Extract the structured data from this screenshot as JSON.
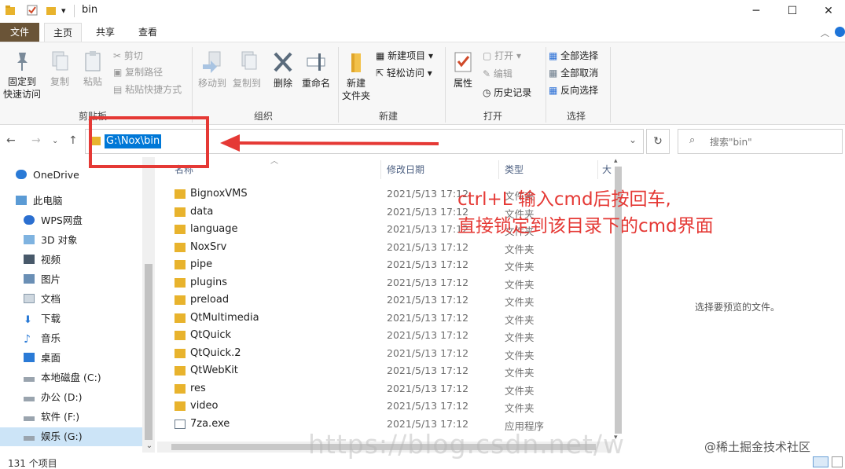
{
  "window": {
    "title": "bin",
    "quick_access_arrow": "▾",
    "controls": {
      "minimize": "─",
      "maximize": "☐",
      "close": "✕"
    }
  },
  "ribbon_tabs": [
    "文件",
    "主页",
    "共享",
    "查看"
  ],
  "ribbon": {
    "clipboard": {
      "pin_label_1": "固定到",
      "pin_label_2": "快速访问",
      "copy": "复制",
      "paste": "粘贴",
      "cut": "剪切",
      "copy_path": "复制路径",
      "paste_shortcut": "粘贴快捷方式",
      "group_label": "剪贴板"
    },
    "organize": {
      "move_to": "移动到",
      "copy_to": "复制到",
      "delete": "删除",
      "rename": "重命名",
      "group_label": "组织"
    },
    "new": {
      "new_folder_1": "新建",
      "new_folder_2": "文件夹",
      "new_item": "新建项目",
      "easy_access": "轻松访问",
      "group_label": "新建"
    },
    "open": {
      "properties": "属性",
      "open": "打开",
      "edit": "编辑",
      "history": "历史记录",
      "group_label": "打开"
    },
    "select": {
      "select_all": "全部选择",
      "select_none": "全部取消",
      "invert": "反向选择",
      "group_label": "选择"
    }
  },
  "address": {
    "path": "G:\\Nox\\bin",
    "search_placeholder": "搜索\"bin\""
  },
  "nav_pane": [
    {
      "label": "OneDrive",
      "icon": "cloud-icon"
    },
    {
      "label": "此电脑",
      "icon": "computer-icon"
    },
    {
      "label": "WPS网盘",
      "icon": "cloud-drive-icon"
    },
    {
      "label": "3D 对象",
      "icon": "cube-icon"
    },
    {
      "label": "视频",
      "icon": "video-icon"
    },
    {
      "label": "图片",
      "icon": "picture-icon"
    },
    {
      "label": "文档",
      "icon": "document-icon"
    },
    {
      "label": "下载",
      "icon": "download-icon"
    },
    {
      "label": "音乐",
      "icon": "music-icon"
    },
    {
      "label": "桌面",
      "icon": "desktop-icon"
    },
    {
      "label": "本地磁盘 (C:)",
      "icon": "drive-icon"
    },
    {
      "label": "办公 (D:)",
      "icon": "drive-icon"
    },
    {
      "label": "软件 (F:)",
      "icon": "drive-icon"
    },
    {
      "label": "娱乐 (G:)",
      "icon": "drive-icon"
    }
  ],
  "columns": {
    "name": "名称",
    "date": "修改日期",
    "type": "类型",
    "size": "大"
  },
  "files": [
    {
      "name": "BignoxVMS",
      "date": "2021/5/13 17:12",
      "type": "文件夹",
      "icon": "folder-icon"
    },
    {
      "name": "data",
      "date": "2021/5/13 17:12",
      "type": "文件夹",
      "icon": "folder-icon"
    },
    {
      "name": "language",
      "date": "2021/5/13 17:12",
      "type": "文件夹",
      "icon": "folder-icon"
    },
    {
      "name": "NoxSrv",
      "date": "2021/5/13 17:12",
      "type": "文件夹",
      "icon": "folder-icon"
    },
    {
      "name": "pipe",
      "date": "2021/5/13 17:12",
      "type": "文件夹",
      "icon": "folder-icon"
    },
    {
      "name": "plugins",
      "date": "2021/5/13 17:12",
      "type": "文件夹",
      "icon": "folder-icon"
    },
    {
      "name": "preload",
      "date": "2021/5/13 17:12",
      "type": "文件夹",
      "icon": "folder-icon"
    },
    {
      "name": "QtMultimedia",
      "date": "2021/5/13 17:12",
      "type": "文件夹",
      "icon": "folder-icon"
    },
    {
      "name": "QtQuick",
      "date": "2021/5/13 17:12",
      "type": "文件夹",
      "icon": "folder-icon"
    },
    {
      "name": "QtQuick.2",
      "date": "2021/5/13 17:12",
      "type": "文件夹",
      "icon": "folder-icon"
    },
    {
      "name": "QtWebKit",
      "date": "2021/5/13 17:12",
      "type": "文件夹",
      "icon": "folder-icon"
    },
    {
      "name": "res",
      "date": "2021/5/13 17:12",
      "type": "文件夹",
      "icon": "folder-icon"
    },
    {
      "name": "video",
      "date": "2021/5/13 17:12",
      "type": "文件夹",
      "icon": "folder-icon"
    },
    {
      "name": "7za.exe",
      "date": "2021/5/13 17:12",
      "type": "应用程序",
      "icon": "exe-icon"
    }
  ],
  "preview_text": "选择要预览的文件。",
  "status": "131 个项目",
  "annotation": {
    "line1": "ctrl+L 输入cmd后按回车,",
    "line2": "直接锁定到该目录下的cmd界面",
    "color": "#e53935"
  },
  "watermark_url": "https://blog.csdn.net/w",
  "watermark_site": "@稀土掘金技术社区"
}
